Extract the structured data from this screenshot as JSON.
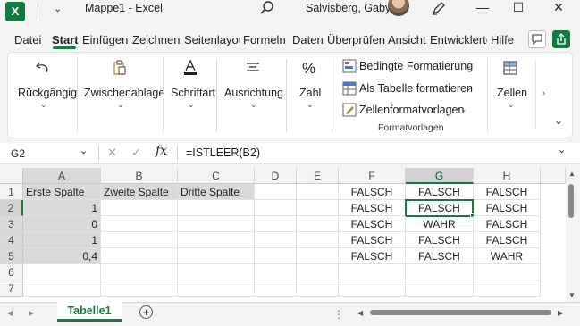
{
  "titlebar": {
    "app_icon": "X",
    "title": "Mappe1  -  Excel",
    "user": "Salvisberg, Gaby",
    "minimize": "—",
    "maximize": "☐",
    "close": "✕"
  },
  "tabs": [
    "Datei",
    "Start",
    "Einfügen",
    "Zeichnen",
    "Seitenlayout",
    "Formeln",
    "Daten",
    "Überprüfen",
    "Ansicht",
    "Entwicklertools",
    "Hilfe"
  ],
  "ribbon": {
    "undo": "Rückgängig",
    "clipboard": "Zwischenablage",
    "font": "Schriftart",
    "alignment": "Ausrichtung",
    "number": "Zahl",
    "number_icon": "%",
    "cond_format": "Bedingte Formatierung",
    "format_table": "Als Tabelle formatieren",
    "cell_styles": "Zellenformatvorlagen",
    "styles_group": "Formatvorlagen",
    "cells": "Zellen"
  },
  "formula_bar": {
    "name_box": "G2",
    "fx": "fx",
    "cancel": "✕",
    "enter": "✓",
    "formula": "=ISTLEER(B2)"
  },
  "columns": [
    "A",
    "B",
    "C",
    "D",
    "E",
    "F",
    "G",
    "H"
  ],
  "rows": [
    "1",
    "2",
    "3",
    "4",
    "5",
    "6",
    "7"
  ],
  "cells": {
    "A1": "Erste Spalte",
    "B1": "Zweite Spalte",
    "C1": "Dritte Spalte",
    "A2": "1",
    "A3": "0",
    "A4": "1",
    "A5": "0,4",
    "F1": "FALSCH",
    "G1": "FALSCH",
    "H1": "FALSCH",
    "F2": "FALSCH",
    "G2": "FALSCH",
    "H2": "FALSCH",
    "F3": "FALSCH",
    "G3": "WAHR",
    "H3": "FALSCH",
    "F4": "FALSCH",
    "G4": "FALSCH",
    "H4": "FALSCH",
    "F5": "FALSCH",
    "G5": "FALSCH",
    "H5": "WAHR"
  },
  "sheet": {
    "tab": "Tabelle1",
    "add": "+",
    "prev": "◀",
    "next": "▶"
  }
}
